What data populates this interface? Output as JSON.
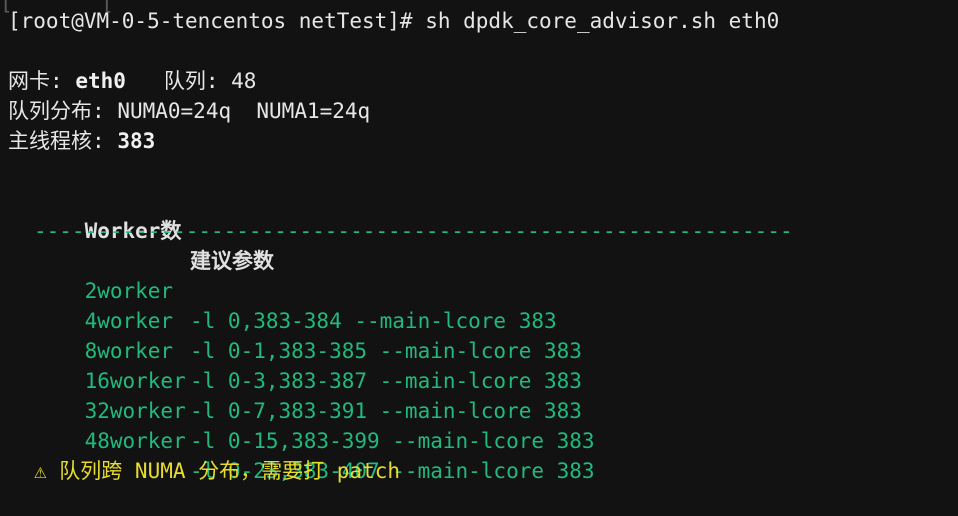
{
  "terminal": {
    "top_remnant": "[       [",
    "prompt": "[root@VM-0-5-tencentos netTest]# sh dpdk_core_advisor.sh eth0",
    "nic": {
      "label": "网卡:",
      "value": "eth0",
      "queue_label": "队列:",
      "queue_value": "48"
    },
    "distribution": {
      "label": "队列分布:",
      "value": "NUMA0=24q  NUMA1=24q"
    },
    "main_core": {
      "label": "主线程核:",
      "value": "383"
    },
    "table": {
      "headers": [
        "Worker数",
        "建议参数"
      ],
      "separator": "------------------------------------------------------------",
      "rows": [
        {
          "worker": "2worker",
          "params": "-l 0,383-384 --main-lcore 383"
        },
        {
          "worker": "4worker",
          "params": "-l 0-1,383-385 --main-lcore 383"
        },
        {
          "worker": "8worker",
          "params": "-l 0-3,383-387 --main-lcore 383"
        },
        {
          "worker": "16worker",
          "params": "-l 0-7,383-391 --main-lcore 383"
        },
        {
          "worker": "32worker",
          "params": "-l 0-15,383-399 --main-lcore 383"
        },
        {
          "worker": "48worker",
          "params": "-l 0-23,383-407 --main-lcore 383"
        }
      ]
    },
    "warning": "⚠ 队列跨 NUMA 分布，需要打 patch",
    "colors": {
      "background": "#121212",
      "text": "#e6e6e6",
      "green": "#21b97e",
      "warning": "#e6dc2e"
    }
  }
}
